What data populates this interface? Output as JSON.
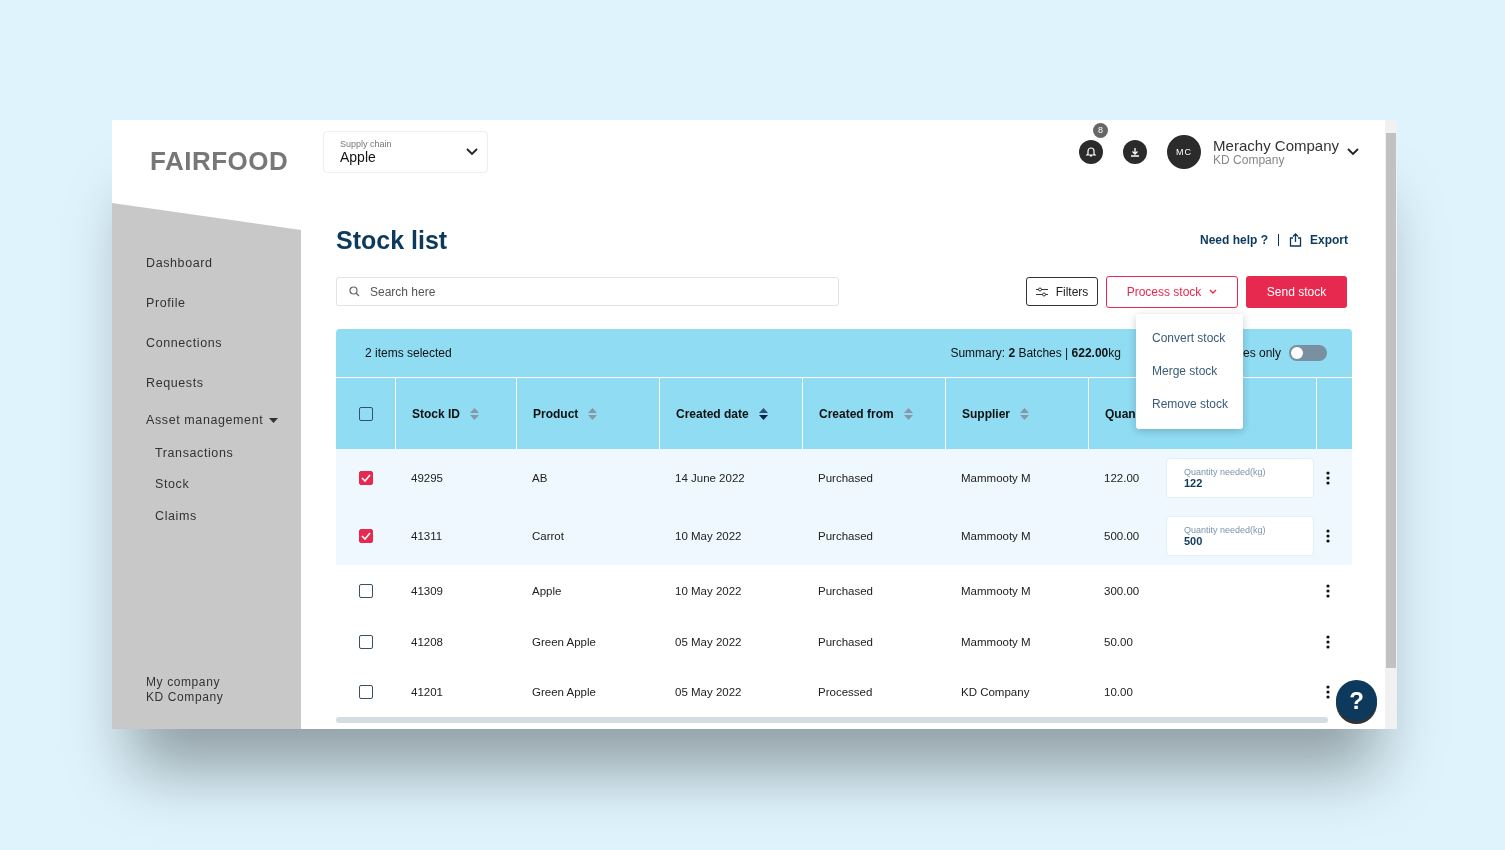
{
  "header": {
    "logo": "FAIRFOOD",
    "supply_chain": {
      "label": "Supply chain",
      "value": "Apple"
    },
    "notifications": {
      "count": "8"
    },
    "user": {
      "initials": "MC",
      "name": "Merachy Company",
      "company": "KD Company"
    }
  },
  "sidebar": {
    "items": [
      {
        "label": "Dashboard"
      },
      {
        "label": "Profile"
      },
      {
        "label": "Connections"
      },
      {
        "label": "Requests"
      },
      {
        "label": "Asset management",
        "expanded": true,
        "children": [
          {
            "label": "Transactions"
          },
          {
            "label": "Stock"
          },
          {
            "label": "Claims"
          }
        ]
      }
    ],
    "footer": {
      "label": "My company",
      "company": "KD Company"
    }
  },
  "page": {
    "title": "Stock list",
    "help_link": "Need help ?",
    "export_link": "Export"
  },
  "search": {
    "placeholder": "Search here"
  },
  "actions": {
    "filters": "Filters",
    "process": "Process stock",
    "send": "Send stock"
  },
  "process_menu": {
    "items": [
      "Convert stock",
      "Merge stock",
      "Remove stock"
    ]
  },
  "selection_bar": {
    "count_text": "2 items selected",
    "summary": "Summary: **2** Batches | **622.00**kg",
    "toggle_label": "es only",
    "toggle_on": false
  },
  "table": {
    "all_checked": false,
    "columns": [
      {
        "label": "Stock ID",
        "sorted": false
      },
      {
        "label": "Product",
        "sorted": false
      },
      {
        "label": "Created date",
        "sorted": true
      },
      {
        "label": "Created from",
        "sorted": false
      },
      {
        "label": "Supplier",
        "sorted": false
      },
      {
        "label": "Quan"
      }
    ],
    "rows": [
      {
        "checked": true,
        "stock_id": "49295",
        "product": "AB",
        "created_date": "14 June 2022",
        "created_from": "Purchased",
        "supplier": "Mammooty M",
        "quantity": "122.00",
        "needed": {
          "label": "Quantity needed(kg)",
          "value": "122"
        }
      },
      {
        "checked": true,
        "stock_id": "41311",
        "product": "Carrot",
        "created_date": "10 May 2022",
        "created_from": "Purchased",
        "supplier": "Mammooty M",
        "quantity": "500.00",
        "needed": {
          "label": "Quantity needed(kg)",
          "value": "500"
        }
      },
      {
        "checked": false,
        "stock_id": "41309",
        "product": "Apple",
        "created_date": "10 May 2022",
        "created_from": "Purchased",
        "supplier": "Mammooty M",
        "quantity": "300.00"
      },
      {
        "checked": false,
        "stock_id": "41208",
        "product": "Green Apple",
        "created_date": "05 May 2022",
        "created_from": "Purchased",
        "supplier": "Mammooty M",
        "quantity": "50.00"
      },
      {
        "checked": false,
        "stock_id": "41201",
        "product": "Green Apple",
        "created_date": "05 May 2022",
        "created_from": "Processed",
        "supplier": "KD Company",
        "quantity": "10.00"
      }
    ]
  },
  "help_button": "?"
}
